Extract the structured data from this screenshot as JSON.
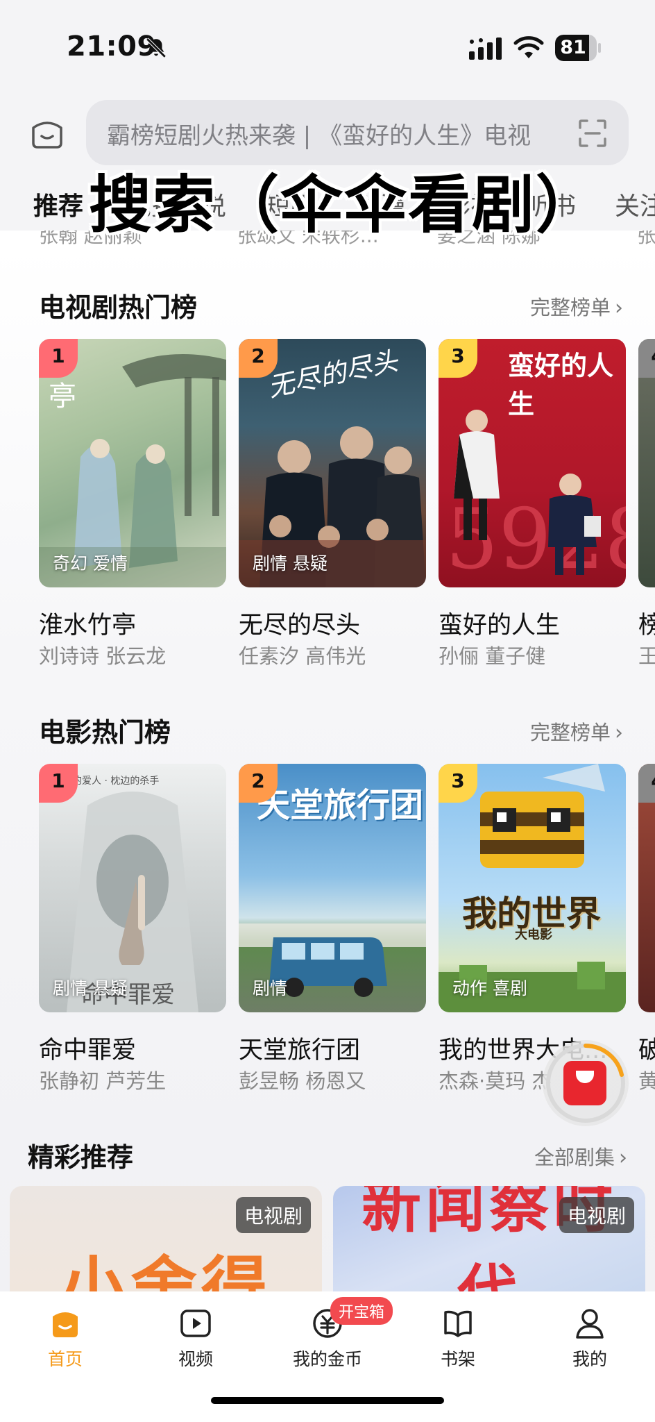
{
  "status_bar": {
    "time": "21:09",
    "battery": "81",
    "battery_level": 0.81
  },
  "search": {
    "placeholder": "霸榜短剧火热来袭 | 《蛮好的人生》电视"
  },
  "overlay_caption": "搜索（伞伞看剧）",
  "tabs": [
    {
      "label": "推荐",
      "active": true
    },
    {
      "label": "免费小说"
    },
    {
      "label": "短剧"
    },
    {
      "label": "动漫"
    },
    {
      "label": "影视"
    },
    {
      "label": "听书"
    },
    {
      "label": "关注"
    }
  ],
  "clipped_row": [
    "张翰 赵丽颖",
    "张颂文 宋轶杉...",
    "姜之涵 陈娜",
    "张"
  ],
  "tv_section": {
    "title": "电视剧热门榜",
    "more": "完整榜单",
    "items": [
      {
        "rank": "1",
        "genre": "奇幻 爱情",
        "title": "淮水竹亭",
        "cast": "刘诗诗 张云龙"
      },
      {
        "rank": "2",
        "genre": "剧情 悬疑",
        "title": "无尽的尽头",
        "cast": "任素汐 高伟光"
      },
      {
        "rank": "3",
        "genre": "",
        "title": "蛮好的人生",
        "cast": "孙俪 董子健"
      },
      {
        "rank": "4",
        "genre": "",
        "title": "榜",
        "cast": "王"
      }
    ]
  },
  "movie_section": {
    "title": "电影热门榜",
    "more": "完整榜单",
    "items": [
      {
        "rank": "1",
        "genre": "剧情 悬疑",
        "title": "命中罪爱",
        "cast": "张静初 芦芳生"
      },
      {
        "rank": "2",
        "genre": "剧情",
        "title": "天堂旅行团",
        "cast": "彭昱畅 杨恩又"
      },
      {
        "rank": "3",
        "genre": "动作 喜剧",
        "title": "我的世界大电...",
        "cast": "杰森·莫玛 杰"
      },
      {
        "rank": "4",
        "genre": "",
        "title": "破",
        "cast": "黄"
      }
    ]
  },
  "recommend": {
    "title": "精彩推荐",
    "more": "全部剧集",
    "items": [
      {
        "badge": "电视剧",
        "poster_text": "小舍得"
      },
      {
        "badge": "电视剧",
        "poster_text": "新闻察时代"
      }
    ]
  },
  "poster_text": {
    "tv1": "亭",
    "tv2": "无尽的尽头",
    "tv3": "蛮好的人生",
    "mv2": "天堂旅行团",
    "mv3_big": "我的世界",
    "mv3_sub": "大电影",
    "mv1": "命中罪爱",
    "mv1_top": "梦中的爱人 · 枕边的杀手"
  },
  "bottom_nav": [
    {
      "label": "首页",
      "icon": "home-icon",
      "active": true
    },
    {
      "label": "视频",
      "icon": "video-icon"
    },
    {
      "label": "我的金币",
      "icon": "coin-icon"
    },
    {
      "label": "书架",
      "icon": "bookshelf-icon"
    },
    {
      "label": "我的",
      "icon": "profile-icon"
    }
  ],
  "coin_badge": "开宝箱",
  "colors": {
    "accent": "#f59a1a",
    "badge_red": "#f24a4f"
  }
}
